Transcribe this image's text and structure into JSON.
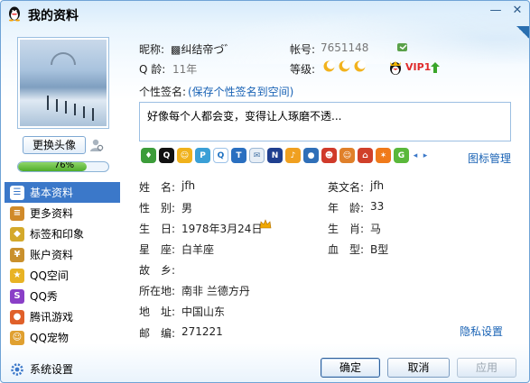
{
  "window": {
    "title": "我的资料",
    "minimize_glyph": "—",
    "close_glyph": "✕"
  },
  "left": {
    "change_avatar_label": "更换头像",
    "progress_text": "76%",
    "progress_value": 0.76,
    "nav_items": [
      {
        "label": "基本资料",
        "icon": "id-card-icon",
        "color": "#3b78c9",
        "active": true
      },
      {
        "label": "更多资料",
        "icon": "notebook-icon",
        "color": "#d08a2a",
        "active": false
      },
      {
        "label": "标签和印象",
        "icon": "tag-icon",
        "color": "#d4a92b",
        "active": false
      },
      {
        "label": "账户资料",
        "icon": "account-icon",
        "color": "#c9902d",
        "active": false
      },
      {
        "label": "QQ空间",
        "icon": "qzone-icon",
        "color": "#e8b324",
        "active": false
      },
      {
        "label": "QQ秀",
        "icon": "qqshow-icon",
        "color": "#8a3fc7",
        "active": false
      },
      {
        "label": "腾讯游戏",
        "icon": "game-icon",
        "color": "#e0602a",
        "active": false
      },
      {
        "label": "QQ宠物",
        "icon": "pet-icon",
        "color": "#e0a030",
        "active": false
      }
    ],
    "system_settings_label": "系统设置"
  },
  "profile": {
    "nickname_label": "昵称:",
    "nickname_value": "▩纠结帝づ゛",
    "account_label": "帐号:",
    "account_value": "7651148",
    "qage_label": "Q 龄:",
    "qage_value": "11年",
    "level_label": "等级:",
    "vip_text": "VIP1",
    "signature_label": "个性签名:",
    "signature_save_link": "(保存个性签名到空间)",
    "signature_text": "好像每个人都会变，变得让人琢磨不透...",
    "icon_manage_link": "图标管理"
  },
  "details": {
    "left_rows": [
      {
        "label": "姓　名:",
        "value": "jfh"
      },
      {
        "label": "性　别:",
        "value": "男"
      },
      {
        "label": "生　日:",
        "value": "1978年3月24日"
      },
      {
        "label": "星　座:",
        "value": "白羊座"
      },
      {
        "label": "故　乡:",
        "value": ""
      },
      {
        "label": "所在地:",
        "value": "南非  兰德方丹"
      },
      {
        "label": "地　址:",
        "value": "中国山东"
      },
      {
        "label": "邮　编:",
        "value": "271221"
      }
    ],
    "right_rows": [
      {
        "label": "英文名:",
        "value": "jfh"
      },
      {
        "label": "年　龄:",
        "value": "33"
      },
      {
        "label": "生　肖:",
        "value": "马"
      },
      {
        "label": "血　型:",
        "value": "B型"
      }
    ],
    "privacy_link": "隐私设置"
  },
  "buttons": {
    "ok": "确定",
    "cancel": "取消",
    "apply": "应用"
  },
  "colors": {
    "accent": "#3b78c9",
    "link": "#1a63b5",
    "vip": "#e02a2a",
    "progress": "#4eac2a"
  }
}
